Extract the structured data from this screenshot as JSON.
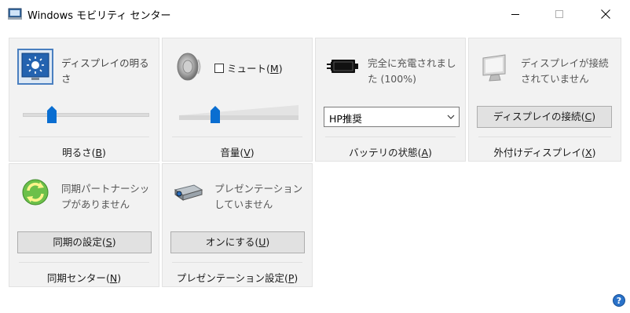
{
  "window": {
    "title": "Windows モビリティ センター"
  },
  "tiles": {
    "brightness": {
      "description": "ディスプレイの明るさ",
      "level": 0.23,
      "footer_label": "明るさ",
      "footer_accel": "B"
    },
    "volume": {
      "mute_label": "ミュート",
      "mute_accel": "M",
      "mute_checked": false,
      "level": 0.3,
      "footer_label": "音量",
      "footer_accel": "V"
    },
    "battery": {
      "status": "完全に充電されました (100%)",
      "plan_selected": "HP推奨",
      "footer_label": "バッテリの状態",
      "footer_accel": "A"
    },
    "external_display": {
      "status": "ディスプレイが接続されていません",
      "button_label": "ディスプレイの接続",
      "button_accel": "C",
      "footer_label": "外付けディスプレイ",
      "footer_accel": "X"
    },
    "sync": {
      "status": "同期パートナーシップがありません",
      "button_label": "同期の設定",
      "button_accel": "S",
      "footer_label": "同期センター",
      "footer_accel": "N"
    },
    "presentation": {
      "status": "プレゼンテーションしていません",
      "button_label": "オンにする",
      "button_accel": "U",
      "footer_label": "プレゼンテーション設定",
      "footer_accel": "P"
    }
  },
  "colors": {
    "accent": "#0a6ed1",
    "tile_bg": "#f2f2f2",
    "button_bg": "#e1e1e1"
  }
}
